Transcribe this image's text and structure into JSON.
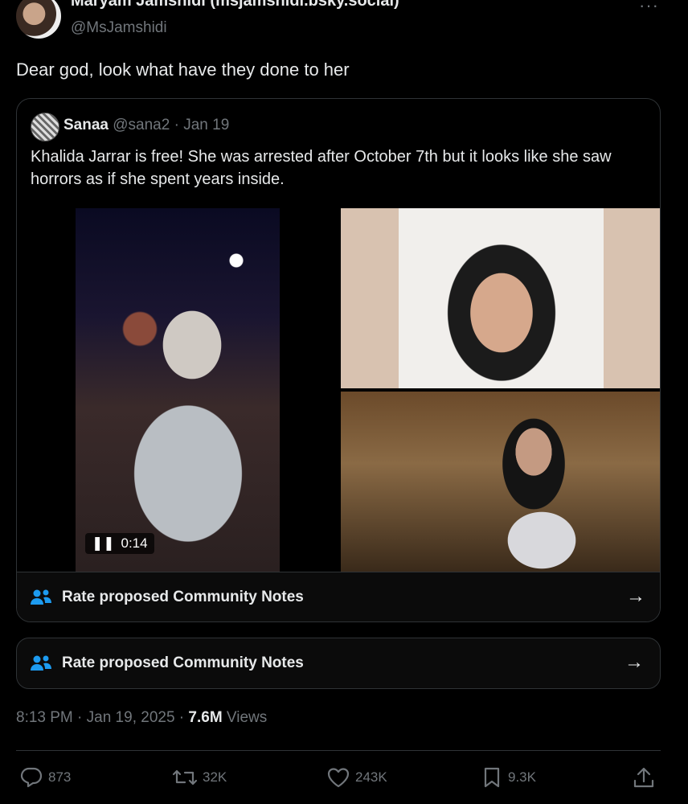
{
  "author": {
    "display_name": "Maryam Jamshidi (msjamshidi.bsky.social)",
    "handle": "@MsJamshidi"
  },
  "more_icon": "more-horizontal-icon",
  "tweet_text": "Dear god, look what have they done to her",
  "quote": {
    "name": "Sanaa",
    "handle": "@sana2",
    "date": "· Jan 19",
    "text": "Khalida Jarrar is free! She was arrested after October 7th but it looks like she saw horrors as if she spent years inside.",
    "video_time": "0:14"
  },
  "community_notes": {
    "label": "Rate proposed Community Notes",
    "icon": "people-icon",
    "icon_color": "#1d9bf0"
  },
  "meta": {
    "time": "8:13 PM · Jan 19, 2025 · ",
    "views_count": "7.6M",
    "views_label": " Views"
  },
  "actions": {
    "replies": "873",
    "reposts": "32K",
    "likes": "243K",
    "bookmarks": "9.3K"
  }
}
